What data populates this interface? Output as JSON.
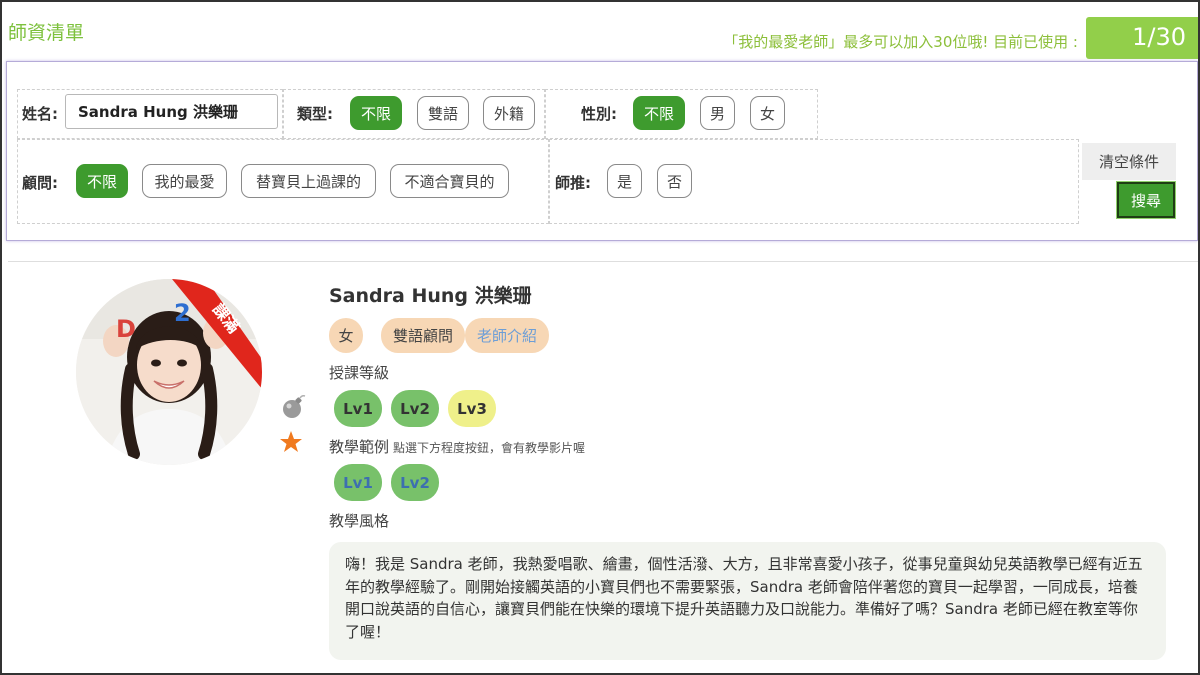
{
  "header": {
    "page_title": "師資清單",
    "quota_text": "「我的最愛老師」最多可以加入30位哦! 目前已使用 :",
    "quota_value": "1/30"
  },
  "filters": {
    "name_label": "姓名:",
    "name_value": "Sandra Hung 洪樂珊",
    "type_label": "類型:",
    "type_options": [
      "不限",
      "雙語",
      "外籍"
    ],
    "type_selected": "不限",
    "gender_label": "性別:",
    "gender_options": [
      "不限",
      "男",
      "女"
    ],
    "gender_selected": "不限",
    "advisor_label": "顧問:",
    "advisor_options": [
      "不限",
      "我的最愛",
      "替寶貝上過課的",
      "不適合寶貝的"
    ],
    "advisor_selected": "不限",
    "recommend_label": "師推:",
    "recommend_options": [
      "是",
      "否"
    ],
    "clear_label": "清空條件",
    "search_label": "搜尋"
  },
  "teacher": {
    "name": "Sandra Hung 洪樂珊",
    "status_ribbon": "課滿",
    "tags": [
      "女",
      "雙語顧問",
      "老師介紹"
    ],
    "levels_label": "授課等級",
    "levels": [
      "Lv1",
      "Lv2",
      "Lv3"
    ],
    "samples_label": "教學範例",
    "samples_hint": "點選下方程度按鈕，會有教學影片喔",
    "samples": [
      "Lv1",
      "Lv2"
    ],
    "style_label": "教學風格",
    "intro": "嗨！我是 Sandra 老師，我熱愛唱歌、繪畫，個性活潑、大方，且非常喜愛小孩子，從事兒童與幼兒英語教學已經有近五年的教學經驗了。剛開始接觸英語的小寶貝們也不需要緊張，Sandra 老師會陪伴著您的寶貝一起學習，一同成長，培養開口說英語的自信心，讓寶貝們能在快樂的環境下提升英語聽力及口說能力。準備好了嗎？Sandra 老師已經在教室等你了喔！"
  },
  "colors": {
    "accent_green": "#3e9b2e",
    "title_green": "#7dc13d",
    "badge_green": "#92cf4a",
    "tag_peach": "#f7d7b5",
    "ribbon_red": "#e0261c",
    "star_orange": "#f07a1f"
  },
  "icons": [
    "bomb-icon",
    "star-icon"
  ]
}
